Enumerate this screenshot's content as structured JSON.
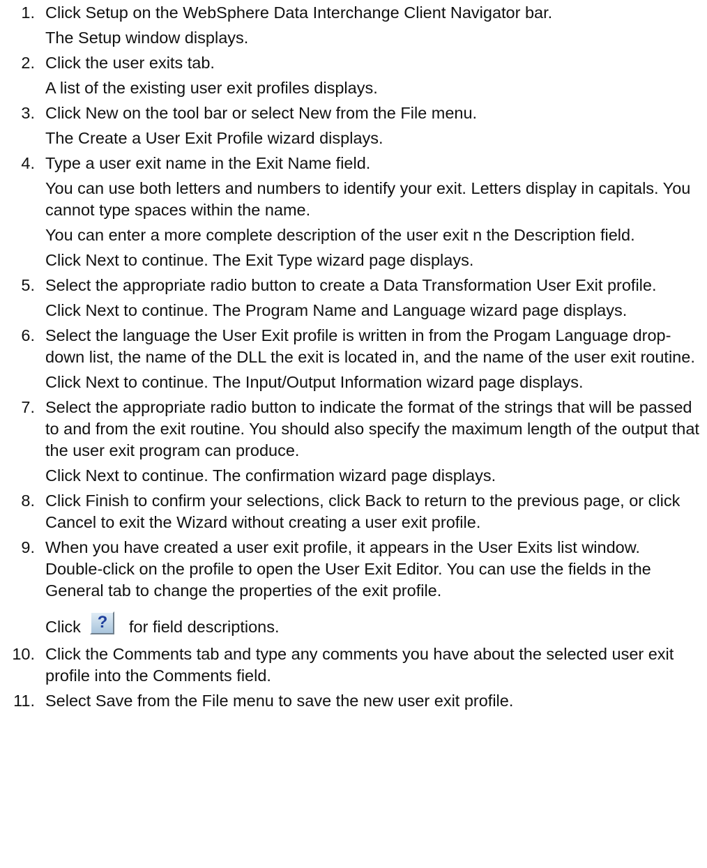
{
  "steps": [
    {
      "number": "1.",
      "text": "Click Setup on the WebSphere Data Interchange Client Navigator bar.",
      "results": [
        "The Setup window displays."
      ]
    },
    {
      "number": "2.",
      "text": "Click the user exits tab.",
      "results": [
        "A list of the existing user exit profiles displays."
      ]
    },
    {
      "number": "3.",
      "text": "Click New on the tool bar or select New from the File menu.",
      "results": [
        "The Create a User Exit Profile wizard displays."
      ]
    },
    {
      "number": "4.",
      "text": "Type a user exit name in the Exit Name field.",
      "results": [
        "You can use both letters and numbers to identify your exit. Letters display in capitals. You cannot type spaces within the name.",
        "You can enter a more complete description of the user exit n the Description field.",
        "Click Next to continue. The Exit Type wizard page displays."
      ]
    },
    {
      "number": "5.",
      "text": "Select the appropriate radio button to create a Data Transformation User Exit profile.",
      "results": [
        "Click Next to continue. The Program Name and Language wizard page displays."
      ]
    },
    {
      "number": "6.",
      "text": "Select the language the User Exit profile is written in from the Progam Language drop-down list, the name of the DLL the exit is located in, and the name of the user exit routine.",
      "results": [
        "Click Next to continue. The Input/Output Information wizard page displays."
      ]
    },
    {
      "number": "7.",
      "text": "Select the appropriate radio button to indicate the format of the strings that will be passed to and from the exit routine. You should also specify the maximum length of the output that the user exit program can produce.",
      "results": [
        "Click Next to continue. The confirmation wizard page displays."
      ]
    },
    {
      "number": "8.",
      "text": "Click Finish to confirm your selections, click Back to return to the previous page, or click Cancel to exit the Wizard without creating a user exit profile.",
      "results": []
    },
    {
      "number": "9.",
      "text": "When you have created a user exit profile, it appears in the User Exits list window. Double-click on the profile to open the User Exit Editor. You can use the fields in the General tab to change the properties of the exit profile.",
      "results": [],
      "help": {
        "before": "Click",
        "icon": "help-question-icon",
        "glyph": "?",
        "after": "for field descriptions."
      }
    },
    {
      "number": "10.",
      "text": "Click the Comments tab and type any comments you have about the selected user exit profile into the Comments field.",
      "results": []
    },
    {
      "number": "11.",
      "text": "Select Save from the File menu to save the new user exit profile.",
      "results": []
    }
  ]
}
